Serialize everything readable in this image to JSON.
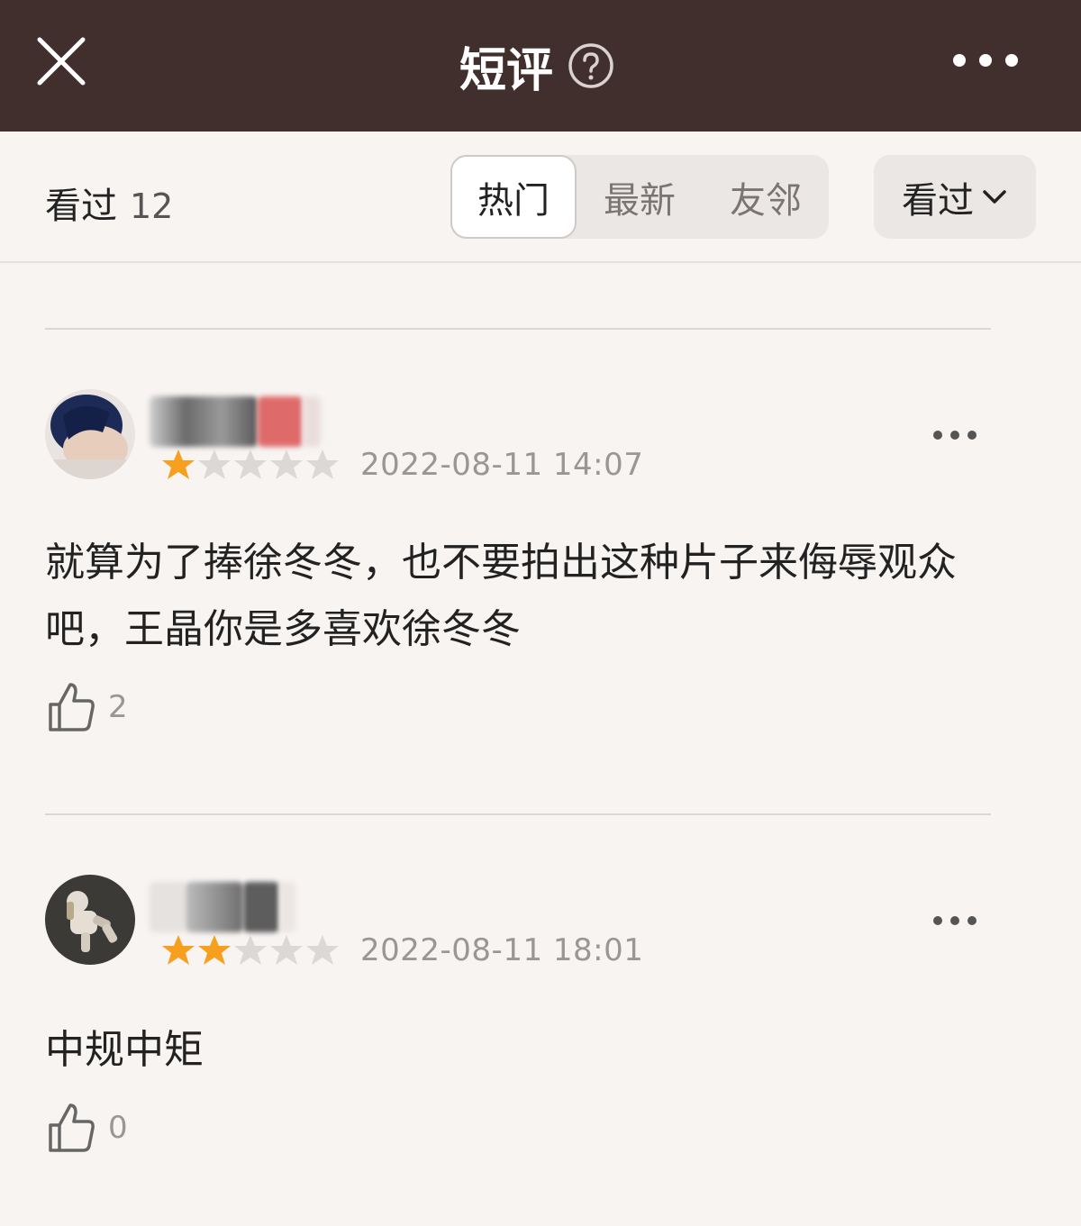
{
  "header": {
    "title": "短评",
    "close_icon": "close-icon",
    "help_icon": "help-circle-icon",
    "more_icon": "more-horizontal-icon",
    "background": "#412f2d"
  },
  "filter": {
    "count_label": "看过",
    "count_value": "12",
    "tabs": [
      "热门",
      "最新",
      "友邻"
    ],
    "active_tab": "热门",
    "dropdown_label": "看过",
    "dropdown_icon": "chevron-down-icon"
  },
  "comments": [
    {
      "rating": 1,
      "max_rating": 5,
      "date": "2022-08-11 14:07",
      "text": "就算为了捧徐冬冬，也不要拍出这种片子来侮辱观众吧，王晶你是多喜欢徐冬冬",
      "likes": "2"
    },
    {
      "rating": 2,
      "max_rating": 5,
      "date": "2022-08-11 18:01",
      "text": "中规中矩",
      "likes": "0"
    }
  ],
  "colors": {
    "star_filled": "#f7a020",
    "star_empty": "#dcd8d5",
    "accent_text": "#222222",
    "muted_text": "#9a9694"
  }
}
